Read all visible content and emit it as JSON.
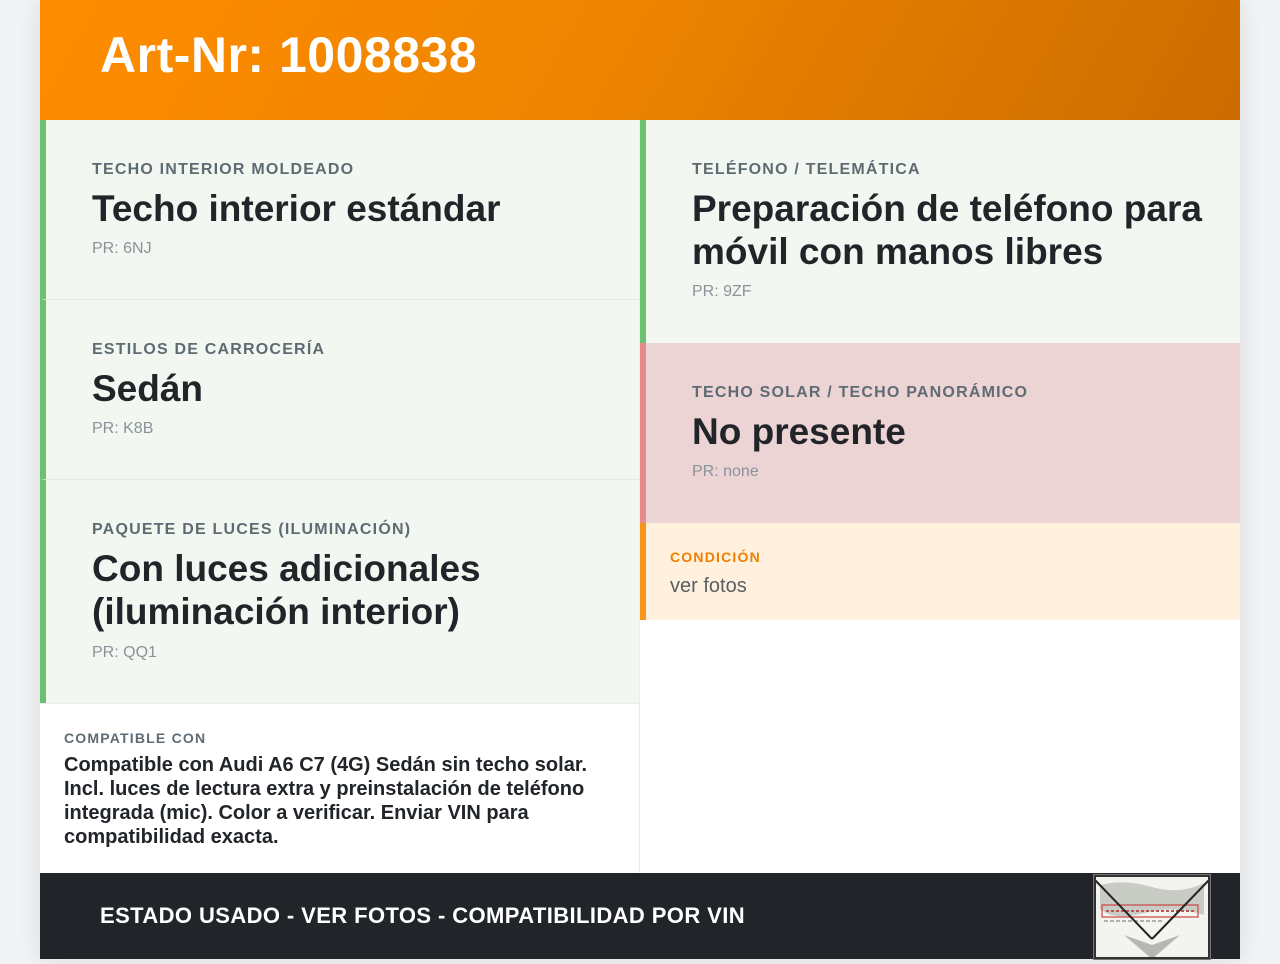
{
  "header": {
    "title": "Art-Nr: 1008838"
  },
  "left": [
    {
      "category": "TECHO INTERIOR MOLDEADO",
      "value": "Techo interior estándar",
      "pr": "PR: 6NJ"
    },
    {
      "category": "ESTILOS DE CARROCERÍA",
      "value": "Sedán",
      "pr": "PR: K8B"
    },
    {
      "category": "PAQUETE DE LUCES (ILUMINACIÓN)",
      "value": "Con luces adicionales (iluminación interior)",
      "pr": "PR: QQ1"
    }
  ],
  "right": [
    {
      "category": "TELÉFONO / TELEMÁTICA",
      "value": "Preparación de teléfono para móvil con manos libres",
      "pr": "PR: 9ZF"
    },
    {
      "category": "TECHO SOLAR / TECHO PANORÁMICO",
      "value": "No presente",
      "pr": "PR: none"
    }
  ],
  "condition": {
    "label": "CONDICIÓN",
    "text": "ver fotos"
  },
  "compatibility": {
    "label": "COMPATIBLE CON",
    "text": "Compatible con Audi A6 C7 (4G) Sedán sin techo solar. Incl. luces de lectura extra y preinstalación de teléfono integrada (mic). Color a verificar. Enviar VIN para compatibilidad exacta."
  },
  "footer": {
    "text": "ESTADO USADO - VER FOTOS - COMPATIBILIDAD POR VIN"
  },
  "colors": {
    "header_orange": "#ff8c00",
    "present_green": "#6cc070",
    "absent_red": "#e58b8f",
    "condition_orange": "#f7941d",
    "footer_dark": "#212529"
  }
}
